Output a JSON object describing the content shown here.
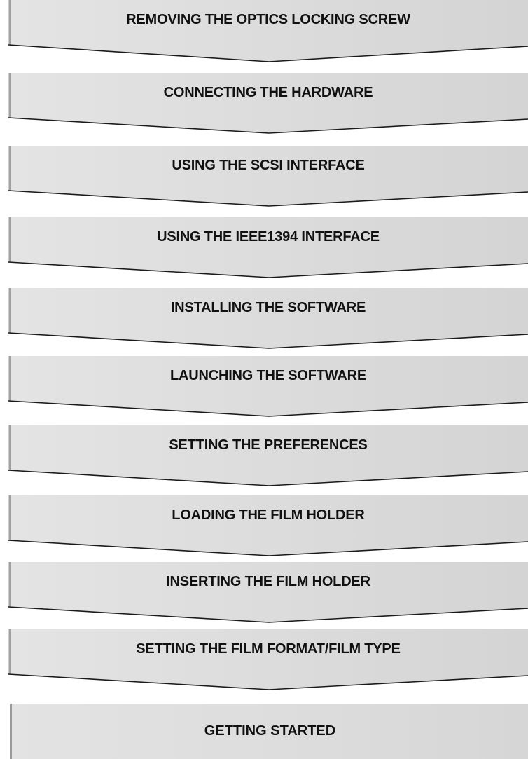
{
  "steps": [
    {
      "label": "REMOVING THE OPTICS LOCKING SCREW"
    },
    {
      "label": "CONNECTING THE HARDWARE"
    },
    {
      "label": "USING THE SCSI INTERFACE"
    },
    {
      "label": "USING THE IEEE1394 INTERFACE"
    },
    {
      "label": "INSTALLING THE SOFTWARE"
    },
    {
      "label": "LAUNCHING THE SOFTWARE"
    },
    {
      "label": "SETTING THE PREFERENCES"
    },
    {
      "label": "LOADING THE FILM HOLDER"
    },
    {
      "label": "INSERTING THE FILM HOLDER"
    },
    {
      "label": "SETTING THE FILM FORMAT/FILM TYPE"
    }
  ],
  "final_step": {
    "label": "GETTING STARTED"
  },
  "colors": {
    "banner_fill": "#dddddd",
    "banner_edge": "#1a1a1a",
    "text": "#111111"
  }
}
